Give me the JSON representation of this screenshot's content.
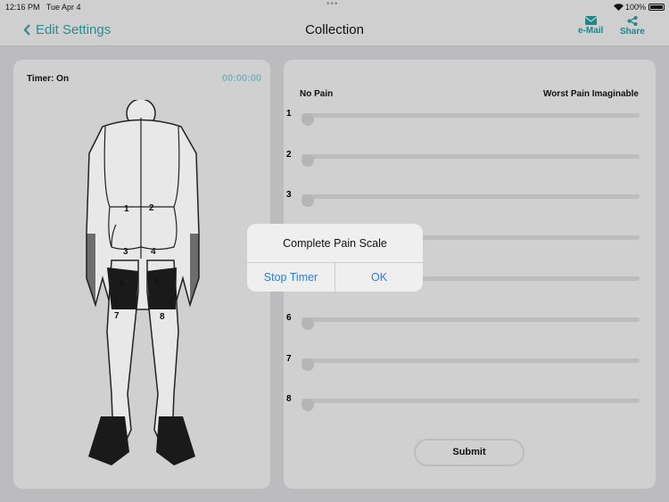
{
  "status_bar": {
    "time": "12:16 PM",
    "date": "Tue Apr 4",
    "battery": "100%",
    "multitask": "•••"
  },
  "nav": {
    "back_label": "Edit Settings",
    "title": "Collection",
    "email_label": "e-Mail",
    "share_label": "Share",
    "accent": "#2d8c90"
  },
  "left_panel": {
    "timer_label": "Timer: On",
    "timer_value": "00:00:00",
    "regions": [
      "1",
      "2",
      "3",
      "4",
      "5",
      "6",
      "7",
      "8"
    ]
  },
  "right_panel": {
    "min_label": "No Pain",
    "max_label": "Worst Pain Imaginable",
    "sliders": [
      {
        "label": "1",
        "value": 0
      },
      {
        "label": "2",
        "value": 0
      },
      {
        "label": "3",
        "value": 0
      },
      {
        "label": "4",
        "value": 0
      },
      {
        "label": "5",
        "value": 0
      },
      {
        "label": "6",
        "value": 0
      },
      {
        "label": "7",
        "value": 0
      },
      {
        "label": "8",
        "value": 0
      }
    ],
    "submit_label": "Submit"
  },
  "alert": {
    "message": "Complete Pain Scale",
    "stop_label": "Stop Timer",
    "ok_label": "OK",
    "button_color": "#2a7fd8"
  }
}
